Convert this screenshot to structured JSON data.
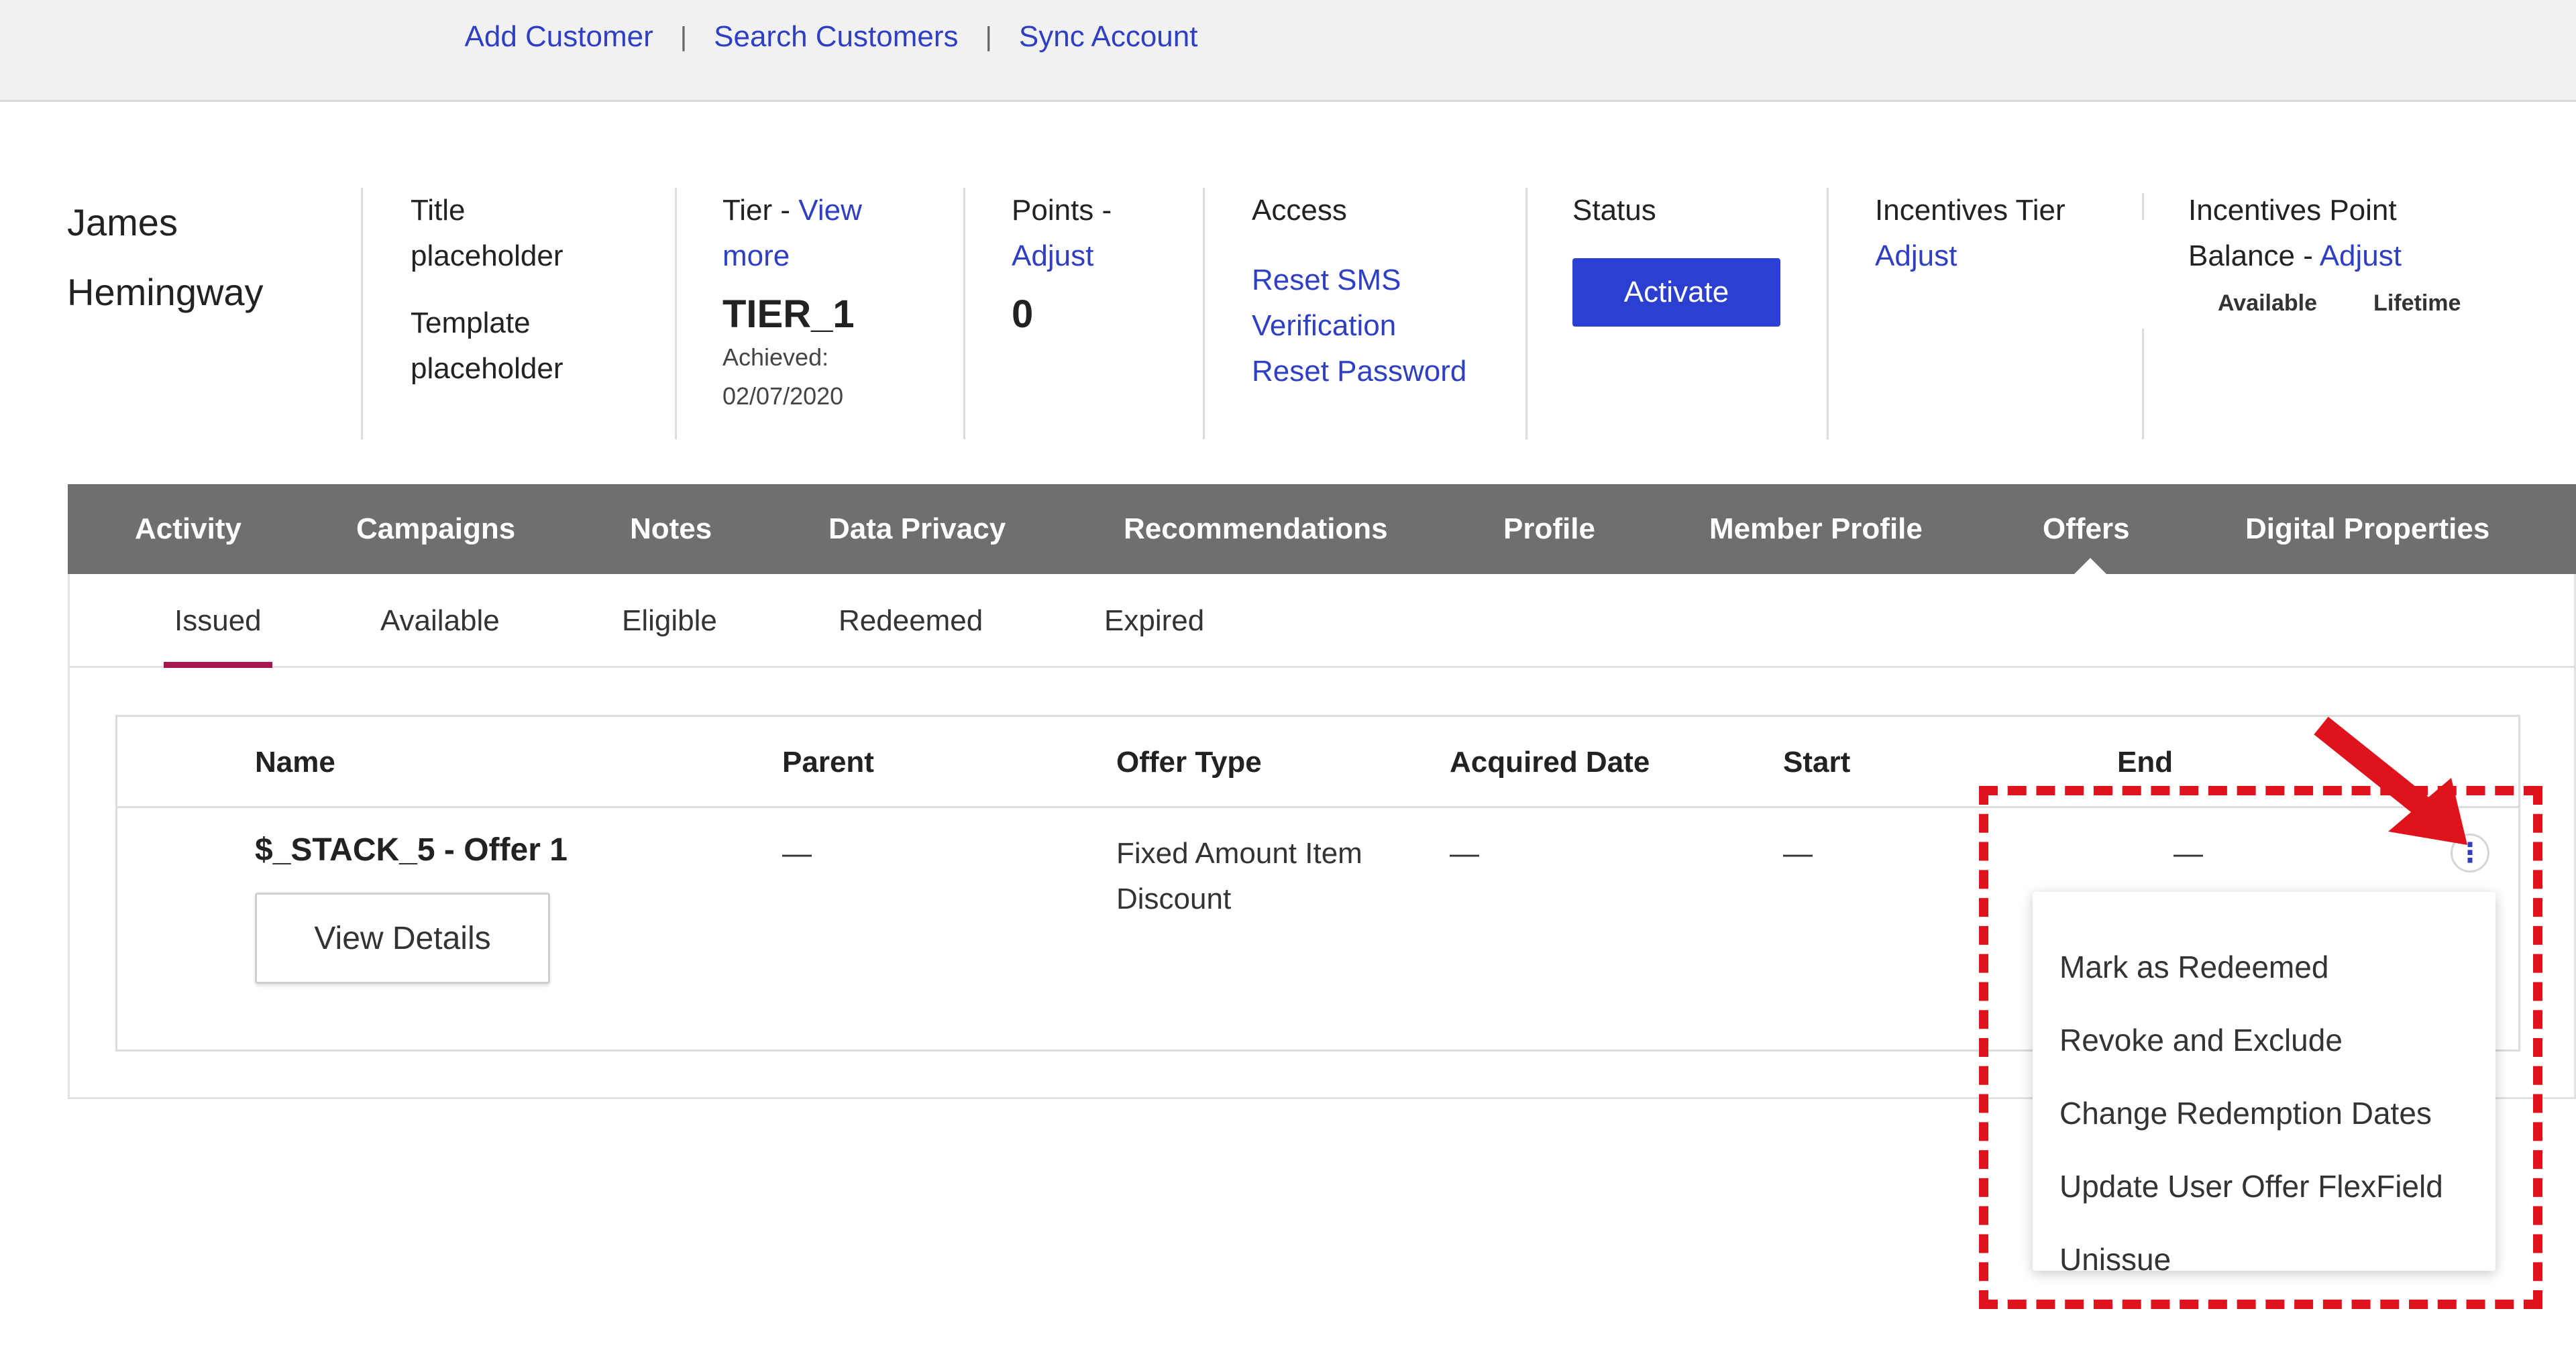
{
  "topnav": {
    "links": [
      "Add Customer",
      "Search Customers",
      "Sync Account"
    ],
    "separator": "|"
  },
  "member": {
    "first_name": "James",
    "last_name": "Hemingway"
  },
  "title_col": {
    "label": "Title",
    "title_value": "placeholder",
    "template_label": "Template",
    "template_value": "placeholder"
  },
  "tier_col": {
    "label": "Tier -",
    "link_part1": "View",
    "link_part2": "more",
    "value": "TIER_1",
    "achieved_label": "Achieved:",
    "achieved_date": "02/07/2020"
  },
  "points_col": {
    "label": "Points -",
    "link": "Adjust",
    "value": "0"
  },
  "access_col": {
    "label": "Access",
    "reset_sms_1": "Reset SMS",
    "reset_sms_2": "Verification",
    "reset_password": "Reset Password"
  },
  "status_col": {
    "label": "Status",
    "button": "Activate"
  },
  "incentives_tier_col": {
    "label": "Incentives Tier",
    "link": "Adjust"
  },
  "incentives_point_col": {
    "label_line1": "Incentives Point",
    "label_line2": "Balance -",
    "link": "Adjust",
    "available": "Available",
    "lifetime": "Lifetime"
  },
  "tabs": [
    "Activity",
    "Campaigns",
    "Notes",
    "Data Privacy",
    "Recommendations",
    "Profile",
    "Member Profile",
    "Offers",
    "Digital Properties"
  ],
  "active_tab": "Offers",
  "subtabs": [
    "Issued",
    "Available",
    "Eligible",
    "Redeemed",
    "Expired"
  ],
  "active_subtab": "Issued",
  "table": {
    "headers": [
      "Name",
      "Parent",
      "Offer Type",
      "Acquired Date",
      "Start",
      "End"
    ],
    "row": {
      "name": "$_STACK_5 - Offer 1",
      "parent": "—",
      "offer_type_line1": "Fixed Amount Item",
      "offer_type_line2": "Discount",
      "acquired_date": "—",
      "start": "—",
      "end": "—",
      "view_details": "View Details"
    }
  },
  "kebab_icon": "⋮",
  "menu": {
    "items": [
      "Mark as Redeemed",
      "Revoke and Exclude",
      "Change Redemption Dates",
      "Update User Offer FlexField",
      "Unissue"
    ]
  },
  "colors": {
    "link": "#2e3fc4",
    "button": "#2b3fd0",
    "tabbar": "#6f6f6f",
    "active_underline": "#a8164f",
    "annotation": "#e0131c"
  }
}
